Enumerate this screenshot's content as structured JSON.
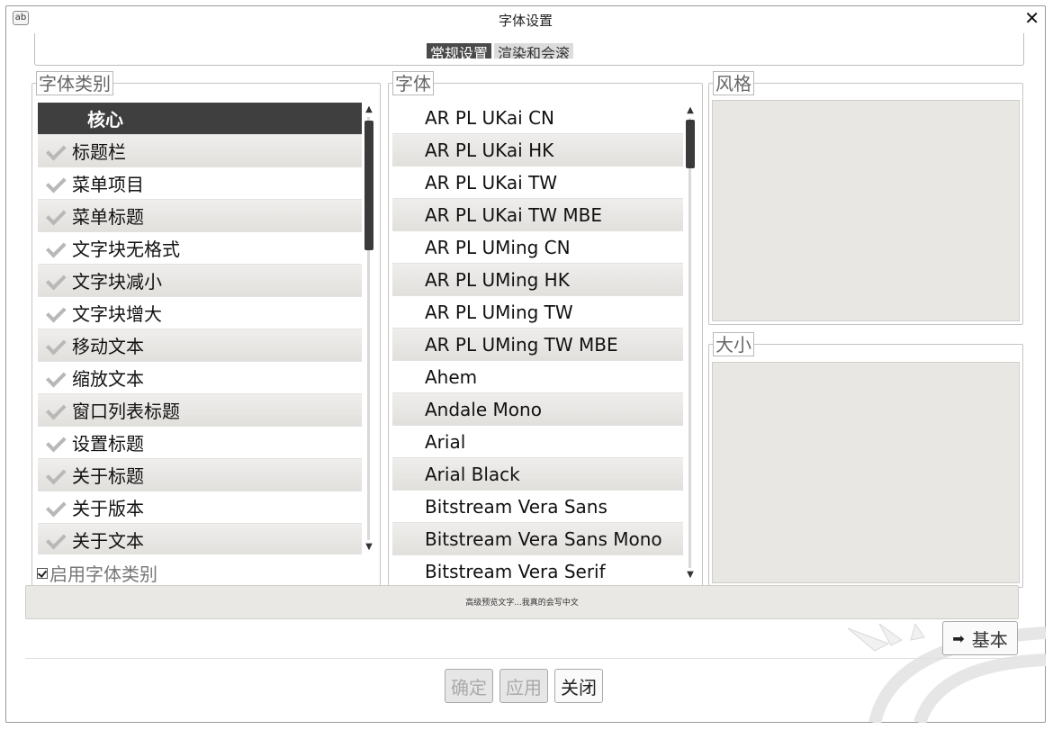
{
  "window": {
    "title": "字体设置",
    "app_icon_text": "ab",
    "close_glyph": "✕"
  },
  "tabs": [
    {
      "label": "常规设置",
      "active": true
    },
    {
      "label": "渲染和会滚",
      "active": false
    }
  ],
  "categories": {
    "legend": "字体类别",
    "selected": "核心",
    "items": [
      "标题栏",
      "菜单项目",
      "菜单标题",
      "文字块无格式",
      "文字块减小",
      "文字块增大",
      "移动文本",
      "缩放文本",
      "窗口列表标题",
      "设置标题",
      "关于标题",
      "关于版本",
      "关于文本"
    ],
    "enable_label": "启用字体类别"
  },
  "fonts": {
    "legend": "字体",
    "items": [
      "AR PL UKai CN",
      "AR PL UKai HK",
      "AR PL UKai TW",
      "AR PL UKai TW MBE",
      "AR PL UMing CN",
      "AR PL UMing HK",
      "AR PL UMing TW",
      "AR PL UMing TW MBE",
      "Ahem",
      "Andale Mono",
      "Arial",
      "Arial Black",
      "Bitstream Vera Sans",
      "Bitstream Vera Sans Mono",
      "Bitstream Vera Serif"
    ]
  },
  "style": {
    "legend": "风格"
  },
  "size": {
    "legend": "大小"
  },
  "preview": {
    "text": "高级预览文字...我真的会写中文"
  },
  "basic_button": {
    "label": "基本",
    "icon": "arrow-right-icon"
  },
  "buttons": {
    "ok": "确定",
    "apply": "应用",
    "close": "关闭"
  },
  "colors": {
    "selected_row": "#3f3f3f",
    "panel_inset": "#e9e7e4"
  }
}
